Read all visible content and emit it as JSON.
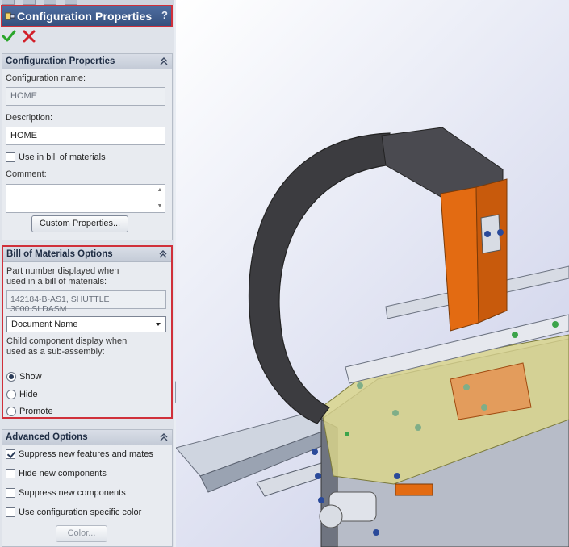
{
  "header": {
    "title": "Configuration Properties",
    "help_glyph": "?"
  },
  "config_section": {
    "title": "Configuration Properties",
    "name_label": "Configuration name:",
    "name_value": "HOME",
    "description_label": "Description:",
    "description_value": "HOME",
    "use_in_bom_label": "Use in bill of materials",
    "use_in_bom_checked": false,
    "comment_label": "Comment:",
    "comment_value": "",
    "custom_properties_button": "Custom Properties..."
  },
  "bom_section": {
    "title": "Bill of Materials Options",
    "part_number_label_line1": "Part number displayed when",
    "part_number_label_line2": "used in a bill of materials:",
    "part_number_value": "142184-B-AS1, SHUTTLE 3000.SLDASM",
    "source_select_value": "Document Name",
    "child_display_label_line1": "Child component display when",
    "child_display_label_line2": "used as a sub-assembly:",
    "options": [
      {
        "label": "Show",
        "selected": true
      },
      {
        "label": "Hide",
        "selected": false
      },
      {
        "label": "Promote",
        "selected": false
      }
    ]
  },
  "advanced_section": {
    "title": "Advanced Options",
    "items": [
      {
        "label": "Suppress new features and mates",
        "checked": true
      },
      {
        "label": "Hide new components",
        "checked": false
      },
      {
        "label": "Suppress new components",
        "checked": false
      },
      {
        "label": "Use configuration specific color",
        "checked": false
      }
    ],
    "color_button": "Color..."
  },
  "colors": {
    "header_bg": "#3d5a8c",
    "highlight_border": "#d0303a",
    "ok_green": "#2aa52a",
    "cancel_red": "#d2202a",
    "model_orange": "#e36b12",
    "model_dark": "#3c3c40",
    "model_yellow": "#d8d68a"
  },
  "icons": {
    "ok": "checkmark-icon",
    "cancel": "x-icon",
    "collapse": "double-chevron-up-icon",
    "dropdown": "chevron-down-icon"
  }
}
